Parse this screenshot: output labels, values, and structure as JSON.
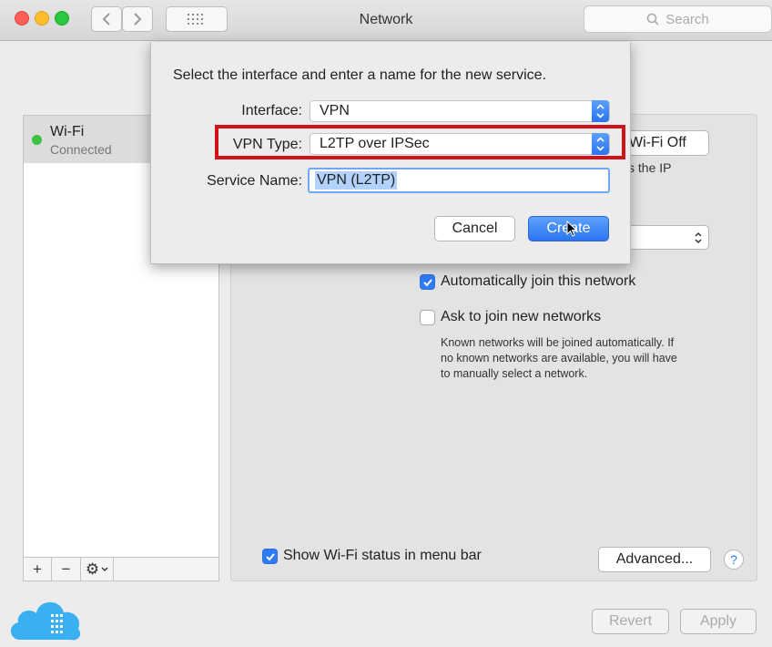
{
  "window": {
    "title": "Network"
  },
  "toolbar": {
    "search_placeholder": "Search"
  },
  "sidebar": {
    "items": [
      {
        "name": "Wi-Fi",
        "status": "Connected",
        "status_color": "#3cc23f"
      }
    ],
    "buttons": {
      "add": "+",
      "remove": "−",
      "gear_menu": "⚙"
    }
  },
  "main": {
    "turn_off_label": "Wi-Fi Off",
    "partial_text": "s the IP",
    "auto_join": {
      "label": "Automatically join this network",
      "checked": true
    },
    "ask_join": {
      "label": "Ask to join new networks",
      "checked": false,
      "help_lines": [
        "Known networks will be joined automatically. If",
        "no known networks are available, you will have",
        "to manually select a network."
      ]
    },
    "show_status": {
      "label": "Show Wi-Fi status in menu bar",
      "checked": true
    },
    "advanced_label": "Advanced...",
    "help_label": "?"
  },
  "footer": {
    "revert_label": "Revert",
    "apply_label": "Apply"
  },
  "sheet": {
    "prompt": "Select the interface and enter a name for the new service.",
    "interface": {
      "label": "Interface:",
      "value": "VPN"
    },
    "vpn_type": {
      "label": "VPN Type:",
      "value": "L2TP over IPSec"
    },
    "service_name": {
      "label": "Service Name:",
      "value": "VPN (L2TP)"
    },
    "cancel_label": "Cancel",
    "create_label": "Create"
  },
  "colors": {
    "accent": "#2f7bf5",
    "highlight_box": "#d0131a",
    "selection": "#b2d1fb"
  }
}
